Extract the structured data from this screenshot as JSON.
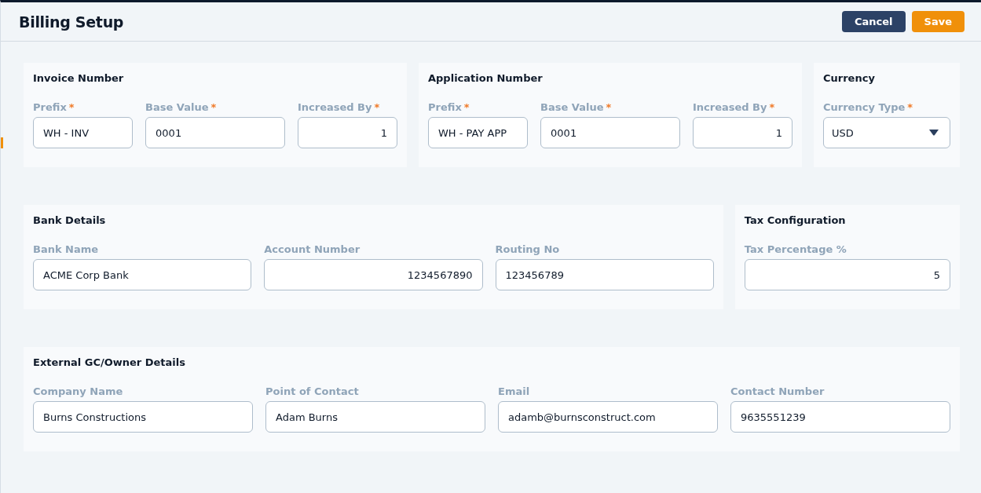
{
  "header": {
    "title": "Billing Setup",
    "buttons": [
      {
        "label": "Cancel",
        "kind": "secondary"
      },
      {
        "label": "Save",
        "kind": "primary"
      }
    ]
  },
  "rows": [
    {
      "sections": [
        {
          "title": "Invoice Number",
          "fields": [
            {
              "label": "Prefix",
              "mark": "*",
              "value": "WH - INV",
              "kind": "text"
            },
            {
              "label": "Base Value",
              "mark": "*",
              "value": "0001",
              "kind": "text"
            },
            {
              "label": "Increased By",
              "mark": "*",
              "value": "1",
              "kind": "number"
            }
          ]
        },
        {
          "title": "Application Number",
          "fields": [
            {
              "label": "Prefix",
              "mark": "*",
              "value": "WH - PAY APP",
              "kind": "text"
            },
            {
              "label": "Base Value",
              "mark": "*",
              "value": "0001",
              "kind": "text"
            },
            {
              "label": "Increased By",
              "mark": "*",
              "value": "1",
              "kind": "number"
            }
          ]
        },
        {
          "title": "Currency",
          "fields": [
            {
              "label": "Currency Type",
              "mark": "*",
              "value": "USD",
              "kind": "select"
            }
          ]
        }
      ]
    },
    {
      "sections": [
        {
          "title": "Bank Details",
          "fields": [
            {
              "label": "Bank Name",
              "value": "ACME Corp Bank",
              "kind": "text"
            },
            {
              "label": "Account Number",
              "value": "1234567890",
              "kind": "number"
            },
            {
              "label": "Routing No",
              "value": "123456789",
              "kind": "text"
            }
          ]
        },
        {
          "title": "Tax Configuration",
          "fields": [
            {
              "label": "Tax Percentage %",
              "value": "5",
              "kind": "number"
            }
          ]
        }
      ]
    },
    {
      "sections": [
        {
          "title": "External GC/Owner Details",
          "fields": [
            {
              "label": "Company Name",
              "value": "Burns Constructions",
              "kind": "text"
            },
            {
              "label": "Point of Contact",
              "value": "Adam Burns",
              "kind": "text"
            },
            {
              "label": "Email",
              "value": "adamb@burnsconstruct.com",
              "kind": "text"
            },
            {
              "label": "Contact Number",
              "value": "9635551239",
              "kind": "text"
            }
          ]
        }
      ]
    }
  ]
}
